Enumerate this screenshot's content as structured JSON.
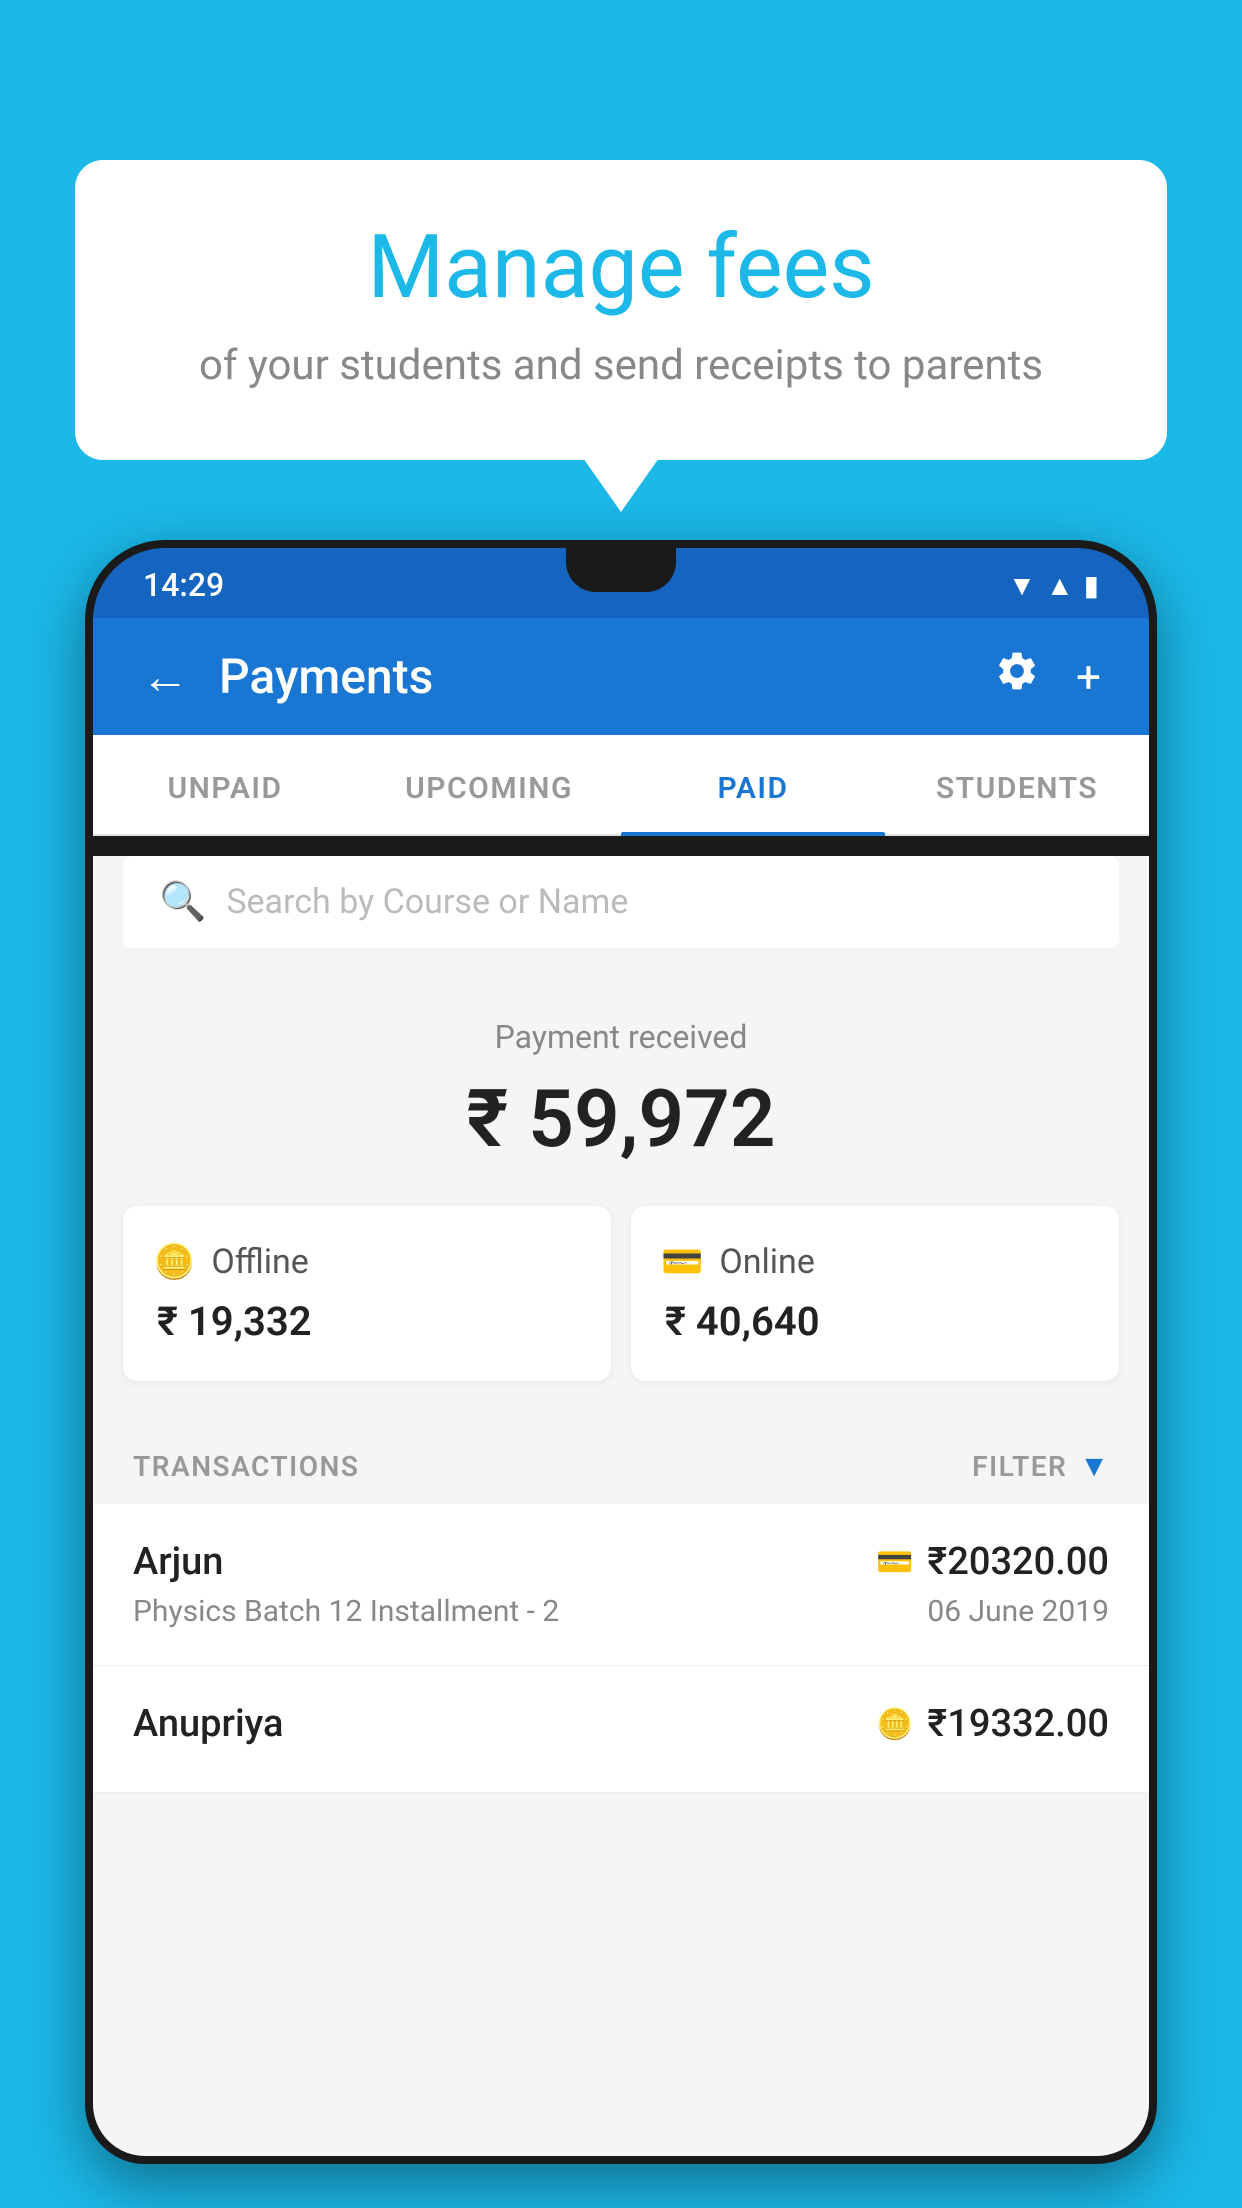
{
  "background_color": "#1BB8E8",
  "hero": {
    "title": "Manage fees",
    "subtitle": "of your students and send receipts to parents"
  },
  "status_bar": {
    "time": "14:29"
  },
  "app_bar": {
    "title": "Payments",
    "back_label": "←",
    "settings_label": "⚙",
    "add_label": "+"
  },
  "tabs": [
    {
      "label": "UNPAID",
      "active": false
    },
    {
      "label": "UPCOMING",
      "active": false
    },
    {
      "label": "PAID",
      "active": true
    },
    {
      "label": "STUDENTS",
      "active": false
    }
  ],
  "search": {
    "placeholder": "Search by Course or Name"
  },
  "payment_summary": {
    "label": "Payment received",
    "amount": "₹ 59,972"
  },
  "payment_cards": [
    {
      "label": "Offline",
      "amount": "₹ 19,332",
      "icon": "offline"
    },
    {
      "label": "Online",
      "amount": "₹ 40,640",
      "icon": "online"
    }
  ],
  "transactions_header": {
    "label": "TRANSACTIONS",
    "filter_label": "FILTER"
  },
  "transactions": [
    {
      "name": "Arjun",
      "course": "Physics Batch 12 Installment - 2",
      "amount": "₹20320.00",
      "date": "06 June 2019",
      "payment_type": "online"
    },
    {
      "name": "Anupriya",
      "course": "",
      "amount": "₹19332.00",
      "date": "",
      "payment_type": "offline"
    }
  ]
}
